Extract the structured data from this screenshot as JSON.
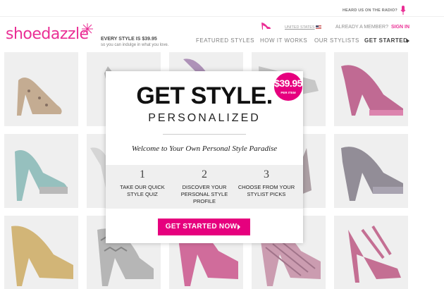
{
  "topbar": {
    "radio_text": "HEARD US ON THE RADIO?",
    "mic_icon": "microphone-icon"
  },
  "header": {
    "logo_text": "shoedazzle",
    "tagline": "EVERY STYLE IS $39.95",
    "subline": "so you can indulge in what you love.",
    "country": "UNITED STATES",
    "member_text": "ALREADY A MEMBER?",
    "signin_label": "SIGN IN"
  },
  "nav": [
    {
      "label": "FEATURED STYLES"
    },
    {
      "label": "HOW IT WORKS"
    },
    {
      "label": "OUR STYLISTS"
    },
    {
      "label": "GET STARTED"
    }
  ],
  "modal": {
    "price": "$39.95",
    "price_sub": "PER ITEM",
    "headline": "GET STYLE.",
    "subhead": "PERSONALIZED",
    "welcome": "Welcome to Your Own Personal Style Paradise",
    "steps": [
      {
        "num": "1",
        "line1": "TAKE OUR QUICK",
        "line2": "STYLE QUIZ"
      },
      {
        "num": "2",
        "line1": "DISCOVER YOUR",
        "line2": "PERSONAL STYLE PROFILE"
      },
      {
        "num": "3",
        "line1": "CHOOSE FROM YOUR",
        "line2": "STYLIST PICKS"
      }
    ],
    "cta_label": "GET STARTED NOW"
  },
  "colors": {
    "brand": "#e6007e"
  }
}
